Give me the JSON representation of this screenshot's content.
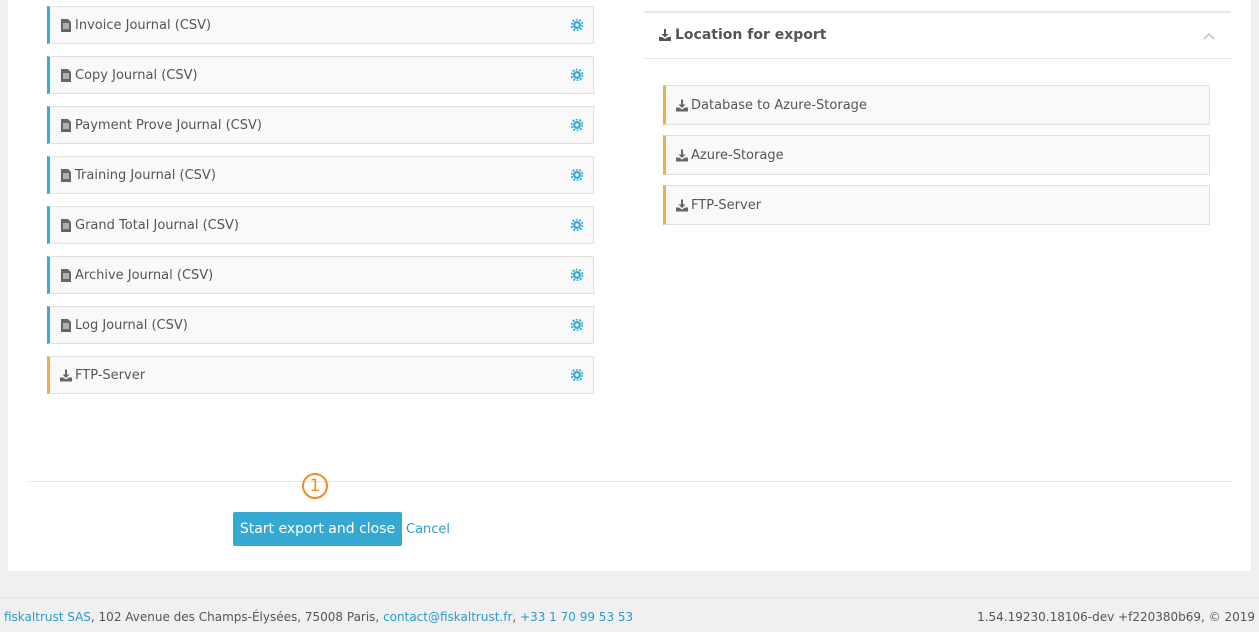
{
  "journals": [
    {
      "label": "Invoice Journal (CSV)",
      "icon": "document-icon"
    },
    {
      "label": "Copy Journal (CSV)",
      "icon": "document-icon"
    },
    {
      "label": "Payment Prove Journal (CSV)",
      "icon": "document-icon"
    },
    {
      "label": "Training Journal (CSV)",
      "icon": "document-icon"
    },
    {
      "label": "Grand Total Journal (CSV)",
      "icon": "document-icon"
    },
    {
      "label": "Archive Journal (CSV)",
      "icon": "document-icon"
    },
    {
      "label": "Log Journal (CSV)",
      "icon": "document-icon"
    },
    {
      "label": "FTP-Server",
      "icon": "download-icon"
    }
  ],
  "location_panel": {
    "title": "Location for export",
    "items": [
      {
        "label": "Database to Azure-Storage",
        "icon": "download-icon"
      },
      {
        "label": "Azure-Storage",
        "icon": "download-icon"
      },
      {
        "label": "FTP-Server",
        "icon": "download-icon"
      }
    ]
  },
  "actions": {
    "marker": "1",
    "start_label": "Start export and close",
    "cancel_label": "Cancel"
  },
  "footer": {
    "company_link": "fiskaltrust SAS",
    "address": ", 102 Avenue des Champs-Élysées, 75008 Paris, ",
    "email": "contact@fiskaltrust.fr",
    "separator": ", ",
    "phone": "+33 1 70 99 53 53",
    "version": "1.54.19230.18106-dev +f220380b69, © 2019"
  },
  "colors": {
    "accent_blue": "#3ba9d3",
    "accent_orange": "#f0ad4e",
    "button": "#36a9d2",
    "marker": "#f08c28"
  }
}
